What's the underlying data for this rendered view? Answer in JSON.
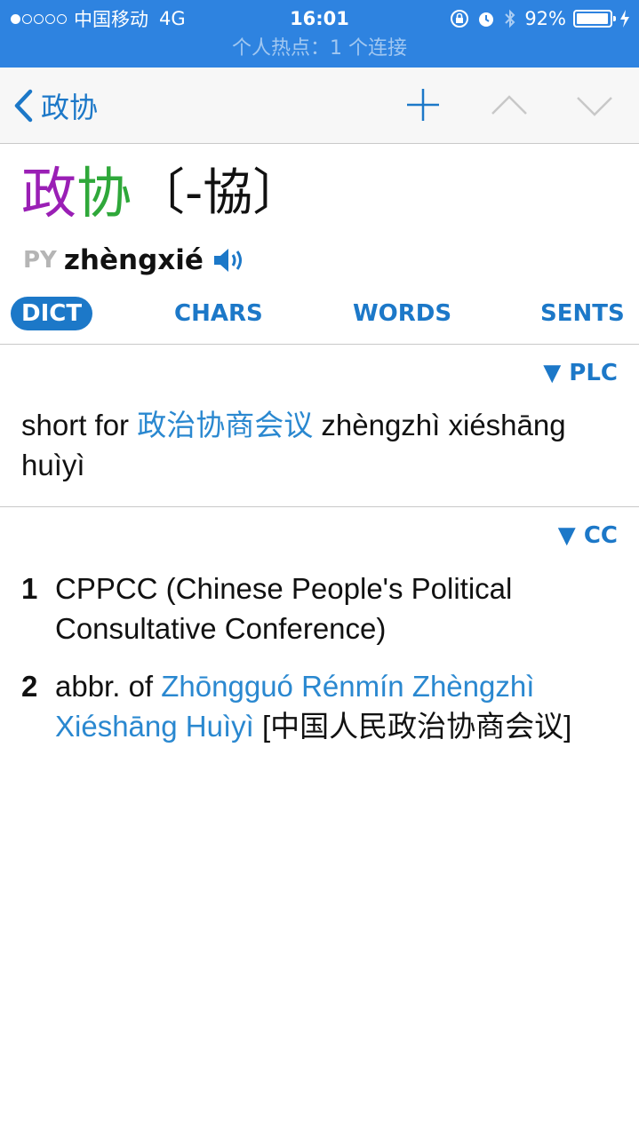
{
  "status": {
    "carrier": "中国移动",
    "network": "4G",
    "time": "16:01",
    "battery": "92%",
    "hotspot": "个人热点：1 个连接"
  },
  "nav": {
    "back_label": "政协"
  },
  "entry": {
    "hanzi_simplified_1": "政",
    "hanzi_simplified_2": "协",
    "traditional": "〔-協〕",
    "py_label": "PY",
    "pinyin": "zhèngxié"
  },
  "tabs": [
    {
      "label": "DICT",
      "active": true
    },
    {
      "label": "CHARS",
      "active": false
    },
    {
      "label": "WORDS",
      "active": false
    },
    {
      "label": "SENTS",
      "active": false
    }
  ],
  "plc": {
    "source": "▼ PLC",
    "prefix": "short for ",
    "link": "政治协商会议",
    "pinyin": " zhèngzhì xiéshāng huìyì"
  },
  "cc": {
    "source": "▼ CC",
    "definitions": [
      {
        "num": "1",
        "text": "CPPCC (Chinese People's Political Consultative Conference)"
      },
      {
        "num": "2",
        "prefix": "abbr. of ",
        "link": "Zhōngguó Rénmín Zhèngzhì Xiéshāng Huìyì",
        "suffix": " [中国人民政治协商会议]"
      }
    ]
  },
  "colors": {
    "statusbar": "#2e83e0",
    "accent": "#1c78c8",
    "link": "#2a88d0",
    "tone4": "#9a1fb5",
    "tone2": "#2fa83a"
  }
}
